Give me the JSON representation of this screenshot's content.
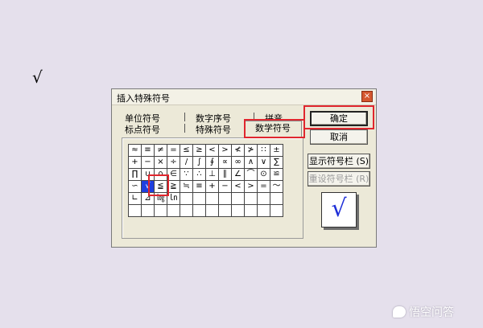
{
  "loose_symbol": "√",
  "dialog": {
    "title": "插入特殊符号",
    "close_glyph": "×",
    "tabs_row1": [
      "单位符号",
      "数字序号",
      "拼音"
    ],
    "tabs_row2": [
      "标点符号",
      "特殊符号",
      "数学符号"
    ],
    "active_tab": "数学符号",
    "grid_rows": [
      [
        "≈",
        "≡",
        "≠",
        "=",
        "≤",
        "≥",
        "<",
        ">",
        "≮",
        "≯",
        "∷",
        "±"
      ],
      [
        "+",
        "−",
        "×",
        "÷",
        "/",
        "∫",
        "∮",
        "∝",
        "∞",
        "∧",
        "∨",
        "∑"
      ],
      [
        "∏",
        "∪",
        "∩",
        "∈",
        "∵",
        "∴",
        "⊥",
        "∥",
        "∠",
        "⌒",
        "⊙",
        "≌"
      ],
      [
        "∽",
        "√",
        "≦",
        "≧",
        "≒",
        "≡",
        "+",
        "−",
        "<",
        ">",
        "=",
        "～"
      ],
      [
        "∟",
        "⊿",
        "㏒",
        "㏑",
        "",
        "",
        "",
        "",
        "",
        "",
        "",
        ""
      ],
      [
        "",
        "",
        "",
        "",
        "",
        "",
        "",
        "",
        "",
        "",
        "",
        ""
      ]
    ],
    "buttons": {
      "ok": "确定",
      "cancel": "取消",
      "show_bar": "显示符号栏 (S)",
      "reset_bar": "重设符号栏 (R)"
    },
    "preview_symbol": "√"
  },
  "watermark": {
    "text": "悟空问答",
    "icon": "speech-bubble-icon"
  },
  "colors": {
    "highlight": "#e0262e",
    "selected_cell": "#1f3fe0",
    "preview_symbol": "#1e2fd8"
  }
}
